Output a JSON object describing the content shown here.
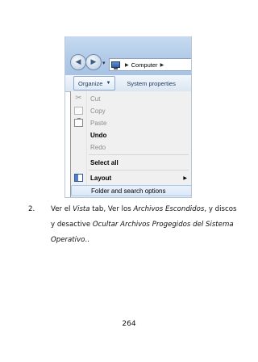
{
  "explorer": {
    "address_crumb": "Computer",
    "command_bar": {
      "organize_label": "Organize",
      "system_properties_label": "System properties"
    },
    "menu": {
      "items": [
        {
          "label": "Cut",
          "state": "disabled",
          "icon": "scissors-icon"
        },
        {
          "label": "Copy",
          "state": "disabled",
          "icon": "copy-icon"
        },
        {
          "label": "Paste",
          "state": "disabled",
          "icon": "paste-icon"
        },
        {
          "label": "Undo",
          "state": "enabled"
        },
        {
          "label": "Redo",
          "state": "disabled"
        },
        {
          "label": "Select all",
          "state": "enabled"
        },
        {
          "label": "Layout",
          "state": "enabled",
          "icon": "layout-icon",
          "submenu": true
        },
        {
          "label": "Folder and search options",
          "state": "highlighted"
        }
      ]
    }
  },
  "step": {
    "number": "2.",
    "parts": [
      "Ver el ",
      "Vista",
      " tab, Ver los ",
      "Archivos Escondidos",
      ", y discos y desactive ",
      "Ocultar Archivos Progegidos del Sistema Operativo",
      ".."
    ]
  },
  "page_number": "264"
}
